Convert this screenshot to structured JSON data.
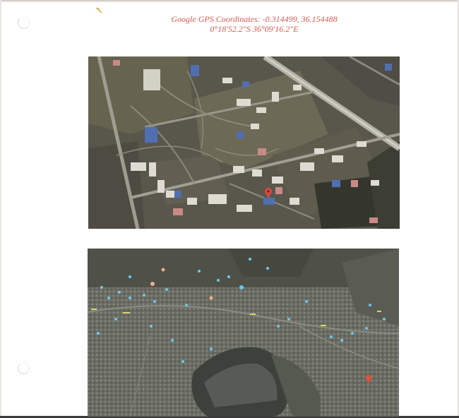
{
  "caption": {
    "line1": "Google GPS Coordinates: -0.314499, 36.154488",
    "line2": "0°18'52.2\"S 36°09'16.2\"E"
  },
  "images": {
    "top": {
      "kind": "satellite-closeup",
      "marker_color": "#d84a45"
    },
    "bottom": {
      "kind": "satellite-overview",
      "marker_color": "#e0503e",
      "point_color": "#6ec7ee"
    }
  }
}
